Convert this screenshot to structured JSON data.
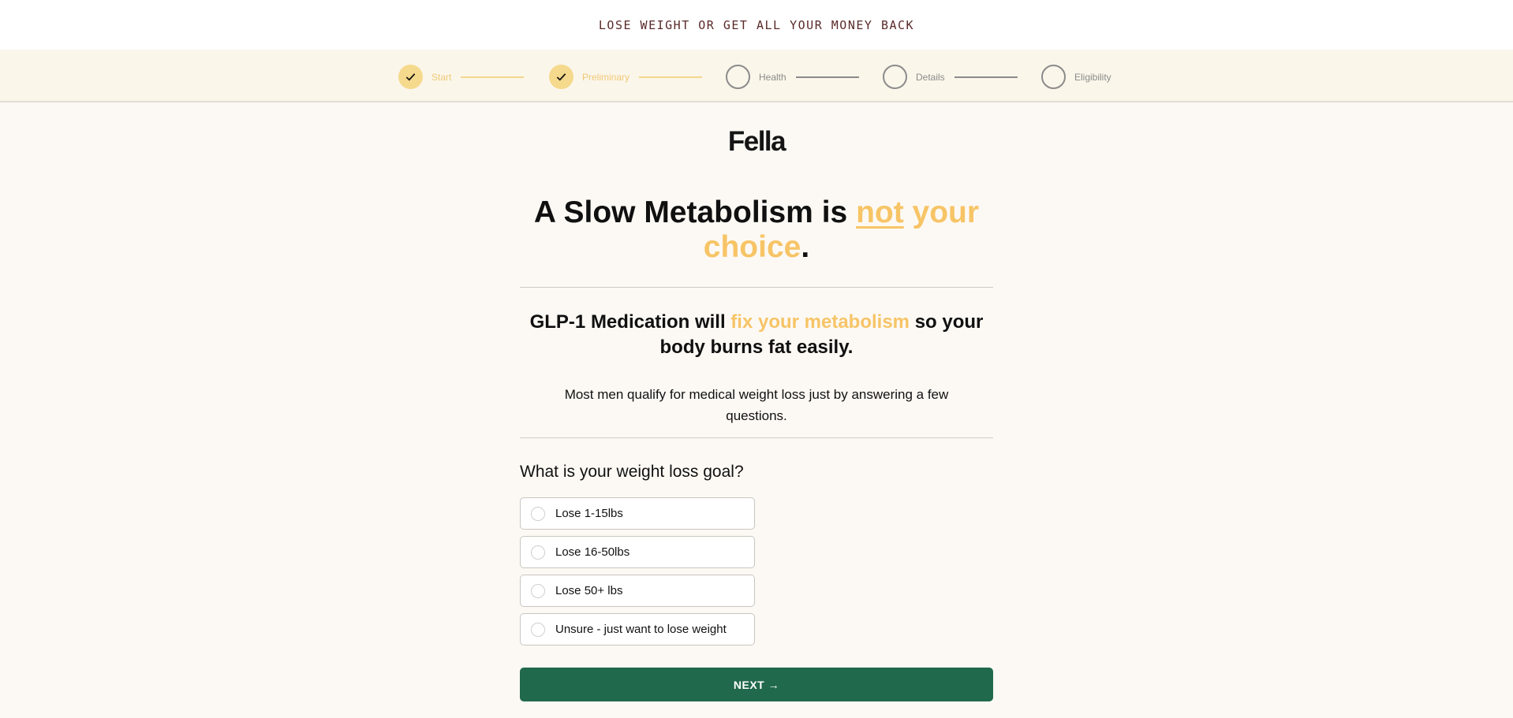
{
  "banner": {
    "text": "LOSE WEIGHT OR GET ALL YOUR MONEY BACK"
  },
  "steps": [
    {
      "label": "Start",
      "status": "complete"
    },
    {
      "label": "Preliminary",
      "status": "complete"
    },
    {
      "label": "Health",
      "status": "incomplete"
    },
    {
      "label": "Details",
      "status": "incomplete"
    },
    {
      "label": "Eligibility",
      "status": "incomplete"
    }
  ],
  "logo": {
    "text": "Fella"
  },
  "headline": {
    "part1": "A Slow Metabolism is ",
    "accent_underlined": "not",
    "accent_rest": " your choice",
    "end": "."
  },
  "subhead": {
    "part1": "GLP-1 Medication will ",
    "accent": "fix your metabolism",
    "part2": " so your body burns fat easily."
  },
  "intro": {
    "text": "Most men qualify for medical weight loss just by answering a few questions."
  },
  "question": {
    "text": "What is your weight loss goal?",
    "options": [
      "Lose 1-15lbs",
      "Lose 16-50lbs",
      "Lose 50+ lbs",
      "Unsure - just want to lose weight"
    ]
  },
  "next_button": {
    "label": "NEXT →"
  },
  "colors": {
    "accent": "#f7c466",
    "primary_button": "#21694c",
    "step_complete": "#f5d98c",
    "banner_text": "#5a2a2a"
  }
}
